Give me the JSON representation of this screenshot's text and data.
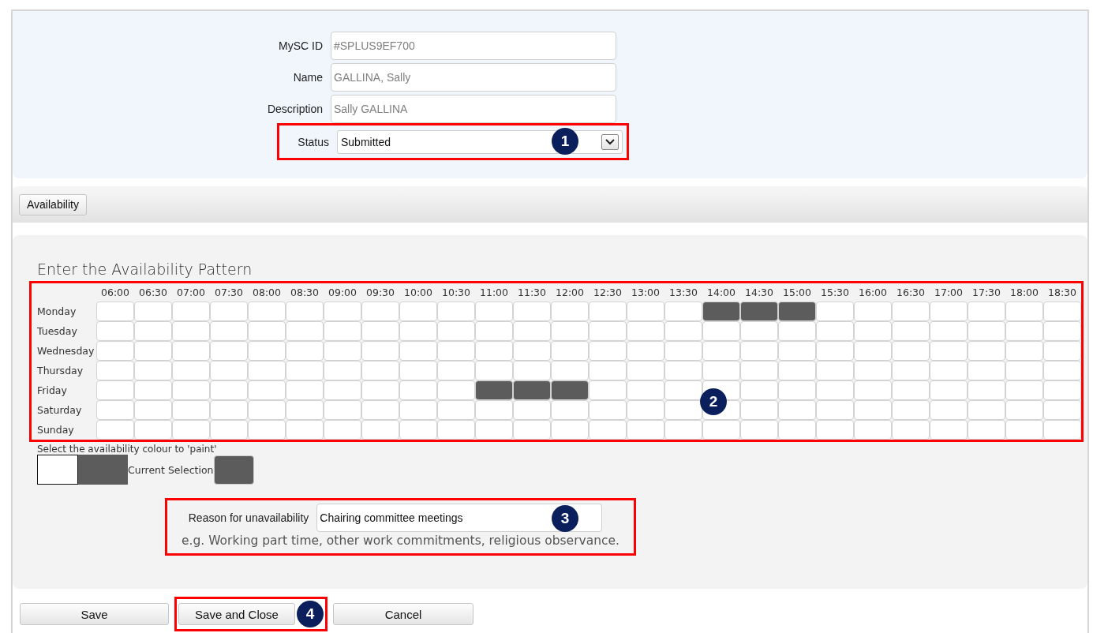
{
  "fields": [
    {
      "label": "MySC ID",
      "value": "#SPLUS9EF700",
      "kind": "text"
    },
    {
      "label": "Name",
      "value": "GALLINA, Sally",
      "kind": "text"
    },
    {
      "label": "Description",
      "value": "Sally GALLINA",
      "kind": "text"
    },
    {
      "label": "Status",
      "value": "Submitted",
      "kind": "select",
      "callout": "1"
    }
  ],
  "tabs": [
    {
      "label": "Availability"
    }
  ],
  "availability": {
    "title": "Enter the Availability Pattern",
    "callout": "2",
    "times": [
      "06:00",
      "06:30",
      "07:00",
      "07:30",
      "08:00",
      "08:30",
      "09:00",
      "09:30",
      "10:00",
      "10:30",
      "11:00",
      "11:30",
      "12:00",
      "12:30",
      "13:00",
      "13:30",
      "14:00",
      "14:30",
      "15:00",
      "15:30",
      "16:00",
      "16:30",
      "17:00",
      "17:30",
      "18:00",
      "18:30"
    ],
    "days": [
      {
        "label": "Monday",
        "filled": [
          false,
          false,
          false,
          false,
          false,
          false,
          false,
          false,
          false,
          false,
          false,
          false,
          false,
          false,
          false,
          false,
          true,
          true,
          true,
          false,
          false,
          false,
          false,
          false,
          false,
          false
        ]
      },
      {
        "label": "Tuesday",
        "filled": [
          false,
          false,
          false,
          false,
          false,
          false,
          false,
          false,
          false,
          false,
          false,
          false,
          false,
          false,
          false,
          false,
          false,
          false,
          false,
          false,
          false,
          false,
          false,
          false,
          false,
          false
        ]
      },
      {
        "label": "Wednesday",
        "filled": [
          false,
          false,
          false,
          false,
          false,
          false,
          false,
          false,
          false,
          false,
          false,
          false,
          false,
          false,
          false,
          false,
          false,
          false,
          false,
          false,
          false,
          false,
          false,
          false,
          false,
          false
        ]
      },
      {
        "label": "Thursday",
        "filled": [
          false,
          false,
          false,
          false,
          false,
          false,
          false,
          false,
          false,
          false,
          false,
          false,
          false,
          false,
          false,
          false,
          false,
          false,
          false,
          false,
          false,
          false,
          false,
          false,
          false,
          false
        ]
      },
      {
        "label": "Friday",
        "filled": [
          false,
          false,
          false,
          false,
          false,
          false,
          false,
          false,
          false,
          false,
          true,
          true,
          true,
          false,
          false,
          false,
          false,
          false,
          false,
          false,
          false,
          false,
          false,
          false,
          false,
          false
        ]
      },
      {
        "label": "Saturday",
        "filled": [
          false,
          false,
          false,
          false,
          false,
          false,
          false,
          false,
          false,
          false,
          false,
          false,
          false,
          false,
          false,
          false,
          false,
          false,
          false,
          false,
          false,
          false,
          false,
          false,
          false,
          false
        ]
      },
      {
        "label": "Sunday",
        "filled": [
          false,
          false,
          false,
          false,
          false,
          false,
          false,
          false,
          false,
          false,
          false,
          false,
          false,
          false,
          false,
          false,
          false,
          false,
          false,
          false,
          false,
          false,
          false,
          false,
          false,
          false
        ]
      }
    ],
    "paint_hint": "Select the availability colour to 'paint'",
    "palette": [
      {
        "color": "#ffffff",
        "selected": false
      },
      {
        "color": "#5c5c5c",
        "selected": true
      }
    ],
    "current_label": "Current Selection",
    "reason": {
      "label": "Reason for unavailability",
      "value": "Chairing committee meetings",
      "hint": "e.g. Working part time, other work commitments, religious observance.",
      "callout": "3"
    }
  },
  "buttons": [
    {
      "label": "Save"
    },
    {
      "label": "Save and Close",
      "callout": "4"
    },
    {
      "label": "Cancel"
    }
  ]
}
